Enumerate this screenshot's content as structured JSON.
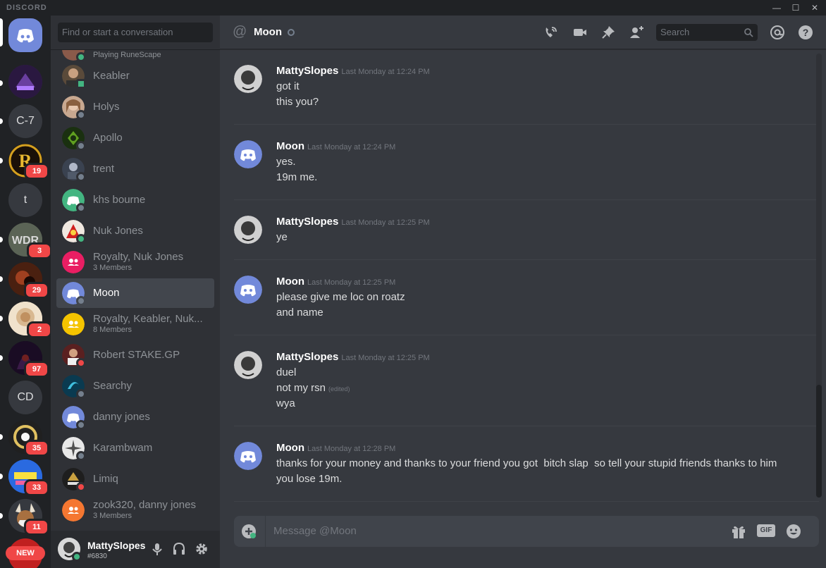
{
  "app": {
    "brand": "DISCORD"
  },
  "window": {
    "minimize": "—",
    "maximize": "☐",
    "close": "✕"
  },
  "servers": [
    {
      "label": "",
      "name": "Discord home"
    },
    {
      "label": "",
      "name": "server-1"
    },
    {
      "label": "C-7"
    },
    {
      "label": "",
      "badge": "19"
    },
    {
      "label": "t"
    },
    {
      "label": "",
      "badge": "3"
    },
    {
      "label": "",
      "badge": "29"
    },
    {
      "label": "",
      "badge": "2"
    },
    {
      "label": "",
      "badge": "97"
    },
    {
      "label": "CD"
    },
    {
      "label": "",
      "badge": "35"
    },
    {
      "label": "",
      "badge": "33"
    },
    {
      "label": "",
      "badge": "11"
    }
  ],
  "new_badge": "NEW",
  "dm": {
    "search_placeholder": "Find or start a conversation",
    "partial_top": "Playing RuneScape",
    "items": [
      {
        "name": "Keabler"
      },
      {
        "name": "Holys"
      },
      {
        "name": "Apollo"
      },
      {
        "name": "trent"
      },
      {
        "name": "khs bourne"
      },
      {
        "name": "Nuk Jones"
      },
      {
        "name": "Royalty, Nuk Jones",
        "sub": "3 Members"
      },
      {
        "name": "Moon"
      },
      {
        "name": "Royalty, Keabler, Nuk...",
        "sub": "8 Members"
      },
      {
        "name": "Robert STAKE.GP"
      },
      {
        "name": "Searchy"
      },
      {
        "name": "danny jones"
      },
      {
        "name": "Karambwam"
      },
      {
        "name": "Limiq"
      },
      {
        "name": "zook320, danny jones",
        "sub": "3 Members"
      }
    ]
  },
  "user": {
    "name": "MattySlopes",
    "tag": "#6830"
  },
  "chat": {
    "channel": "Moon",
    "search_placeholder": "Search",
    "composer_placeholder": "Message @Moon",
    "gif_label": "GIF",
    "messages": [
      {
        "author": "MattySlopes",
        "time": "Last Monday at 12:24 PM",
        "lines": [
          "got it",
          "this you?"
        ]
      },
      {
        "author": "Moon",
        "time": "Last Monday at 12:24 PM",
        "lines": [
          "yes.",
          "19m me."
        ]
      },
      {
        "author": "MattySlopes",
        "time": "Last Monday at 12:25 PM",
        "lines": [
          "ye"
        ]
      },
      {
        "author": "Moon",
        "time": "Last Monday at 12:25 PM",
        "lines": [
          "please give me loc on roatz",
          "and name"
        ]
      },
      {
        "author": "MattySlopes",
        "time": "Last Monday at 12:25 PM",
        "lines": [
          "duel",
          "not my rsn",
          "wya"
        ],
        "edited": "(edited)"
      },
      {
        "author": "Moon",
        "time": "Last Monday at 12:28 PM",
        "lines": [
          "thanks for your money and thanks to your friend you got  bitch slap  so tell your stupid friends thanks to him",
          "you lose 19m."
        ]
      }
    ]
  },
  "colors": {
    "blurple": "#7289da",
    "online": "#43b581",
    "dnd": "#f04747",
    "idle_offline": "#747f8d"
  }
}
